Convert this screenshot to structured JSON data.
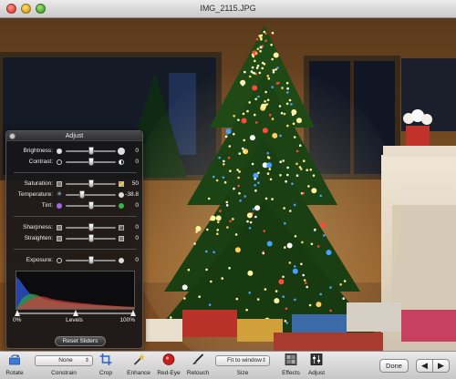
{
  "window": {
    "title": "IMG_2115.JPG"
  },
  "adjust_panel": {
    "title": "Adjust",
    "sliders": [
      {
        "label": "Brightness:",
        "value": "0",
        "level": 0.5
      },
      {
        "label": "Contrast:",
        "value": "0",
        "level": 0.5
      },
      {
        "label": "Saturation:",
        "value": "50",
        "level": 0.5
      },
      {
        "label": "Temperature:",
        "value": "-38.8",
        "level": 0.3
      },
      {
        "label": "Tint:",
        "value": "0",
        "level": 0.5
      },
      {
        "label": "Sharpness:",
        "value": "0",
        "level": 0.5
      },
      {
        "label": "Straighten:",
        "value": "0",
        "level": 0.5
      },
      {
        "label": "Exposure:",
        "value": "0",
        "level": 0.5
      }
    ],
    "levels": {
      "min_label": "0%",
      "label": "Levels",
      "max_label": "100%"
    },
    "reset_label": "Reset Sliders"
  },
  "toolbar": {
    "rotate_label": "Rotate",
    "constrain_value": "None",
    "constrain_label": "Constrain",
    "crop_label": "Crop",
    "enhance_label": "Enhance",
    "redeye_label": "Red-Eye",
    "retouch_label": "Retouch",
    "size_value": "Fit to window",
    "size_label": "Size",
    "effects_label": "Effects",
    "adjust_label": "Adjust",
    "done_label": "Done",
    "prev_symbol": "◀",
    "next_symbol": "▶"
  },
  "colors": {
    "hud_background": "#161618",
    "toolbar_background": "#d9d9d9",
    "tree_green": "#1f4a16",
    "light_yellow": "#fff3a0"
  }
}
